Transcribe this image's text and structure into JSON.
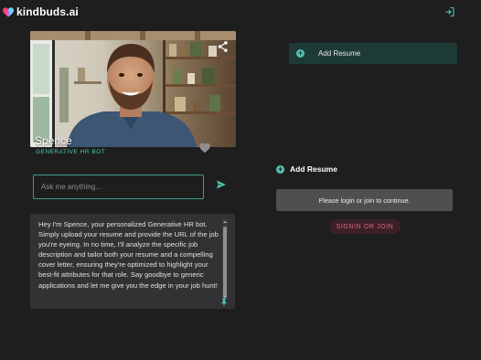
{
  "app": {
    "brand_name": "kindbuds.ai",
    "colors": {
      "accent": "#4fc6b1",
      "background": "#1e1e1f",
      "signin_text": "#d9677c"
    }
  },
  "header": {
    "logo_icon": "heart-logo-icon",
    "login_icon": "login-icon"
  },
  "bot": {
    "name": "Spence",
    "role": "GENERATIVE HR BOT",
    "share_icon": "share-icon",
    "favorite_icon": "heart-icon"
  },
  "chat": {
    "placeholder": "Ask me anything...",
    "send_icon": "send-icon",
    "intro": "Hey I'm Spence, your personalized Generative HR bot. Simply upload your resume and provide the URL of the job you're eyeing. In no time, I'll analyze the specific job description and tailor both your resume and a compelling cover letter, ensuring they're optimized to highlight your best-fit attributes for that role. Say goodbye to generic applications and let me give you the edge in your job hunt!",
    "pin_icon": "pin-icon"
  },
  "sidebar": {
    "resume_bar_label": "Add Resume",
    "add_resume_label": "Add Resume",
    "plus_symbol": "+",
    "login_notice": "Please login or join to continue.",
    "signin_label": "SIGNIN OR JOIN"
  }
}
